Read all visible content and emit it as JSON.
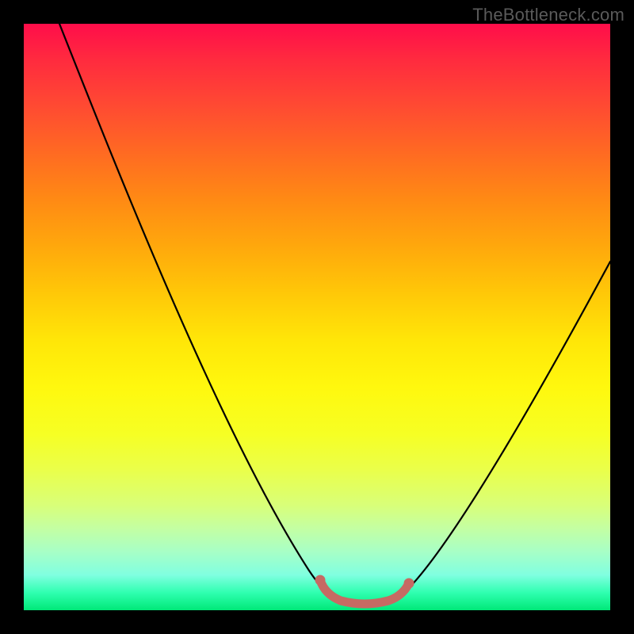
{
  "watermark": "TheBottleneck.com",
  "chart_data": {
    "type": "line",
    "title": "",
    "xlabel": "",
    "ylabel": "",
    "xlim": [
      0,
      100
    ],
    "ylim": [
      0,
      100
    ],
    "series": [
      {
        "name": "bottleneck-curve",
        "x": [
          10,
          15,
          20,
          25,
          30,
          35,
          40,
          45,
          50,
          52,
          56,
          60,
          64,
          66,
          70,
          75,
          80,
          85,
          90,
          95,
          100
        ],
        "y": [
          100,
          90,
          80,
          70,
          60,
          50,
          40,
          30,
          18,
          10,
          3,
          1,
          1,
          3,
          10,
          18,
          28,
          38,
          48,
          55,
          62
        ]
      }
    ],
    "flat_segment": {
      "x_start": 54,
      "x_end": 66,
      "y": 2
    },
    "background_gradient": {
      "top_color": "#ff0d4a",
      "bottom_color": "#00e878"
    }
  }
}
